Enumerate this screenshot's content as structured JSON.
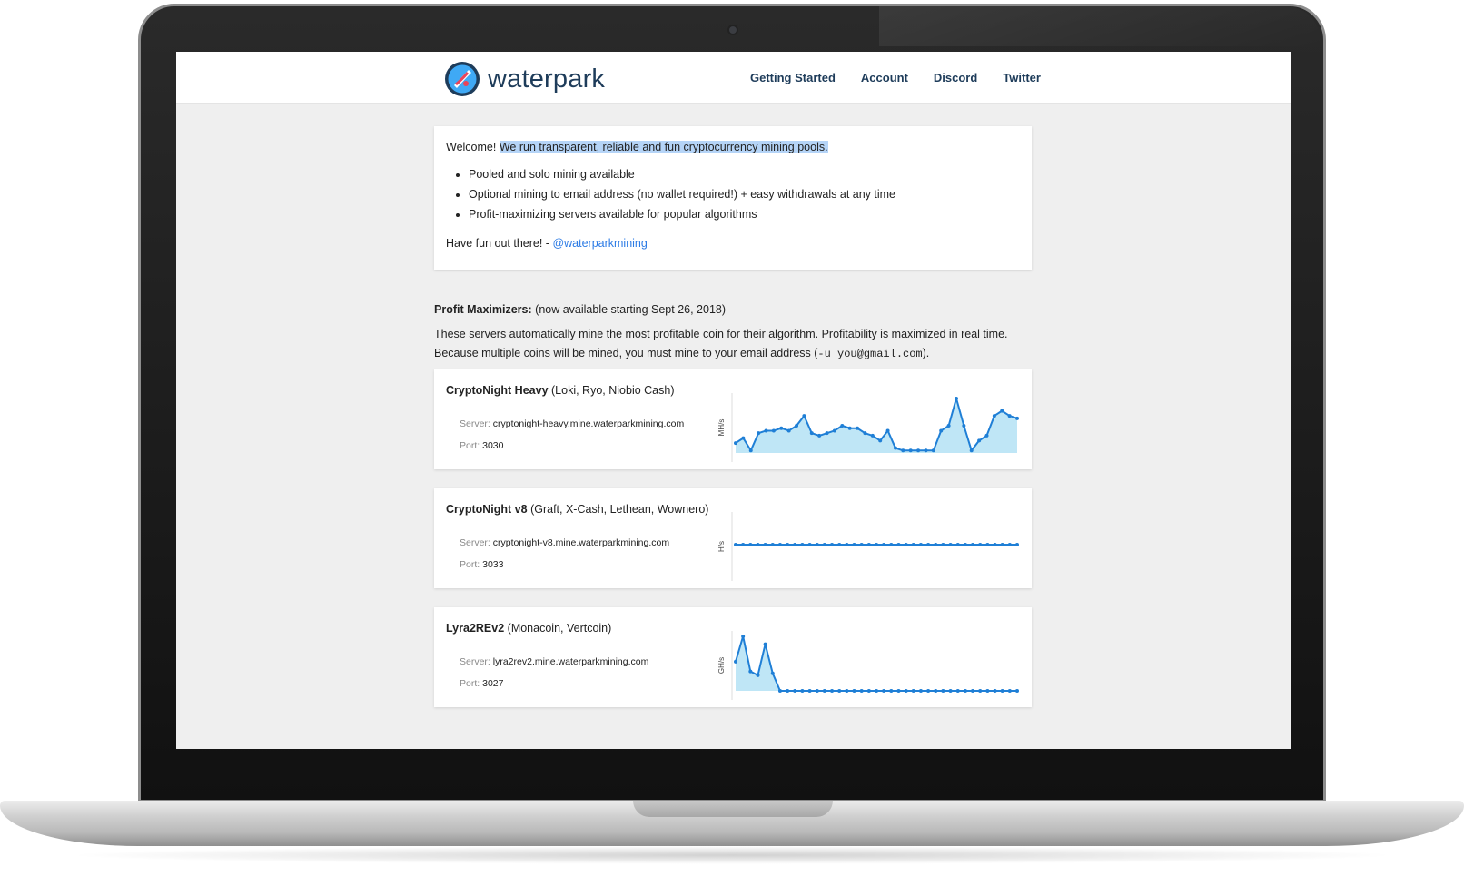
{
  "header": {
    "brand": "waterpark",
    "nav": [
      "Getting Started",
      "Account",
      "Discord",
      "Twitter"
    ]
  },
  "welcome": {
    "greeting": "Welcome!",
    "tagline": "We run transparent, reliable and fun cryptocurrency mining pools.",
    "bullets": [
      "Pooled and solo mining available",
      "Optional mining to email address (no wallet required!) + easy withdrawals at any time",
      "Profit-maximizing servers available for popular algorithms"
    ],
    "signoff": "Have fun out there! -",
    "handle": "@waterparkmining"
  },
  "profit": {
    "title": "Profit Maximizers:",
    "subtitle": "(now available starting Sept 26, 2018)",
    "desc1": "These servers automatically mine the most profitable coin for their algorithm. Profitability is maximized in real time.",
    "desc2_pre": "Because multiple coins will be mined, you must mine to your email address (",
    "desc2_code": "-u you@gmail.com",
    "desc2_post": ")."
  },
  "labels": {
    "server": "Server:",
    "port": "Port:"
  },
  "servers": [
    {
      "name": "CryptoNight Heavy",
      "coins": "(Loki, Ryo, Niobio Cash)",
      "server": "cryptonight-heavy.mine.waterparkmining.com",
      "port": "3030"
    },
    {
      "name": "CryptoNight v8",
      "coins": "(Graft, X-Cash, Lethean, Wownero)",
      "server": "cryptonight-v8.mine.waterparkmining.com",
      "port": "3033"
    },
    {
      "name": "Lyra2REv2",
      "coins": "(Monacoin, Vertcoin)",
      "server": "lyra2rev2.mine.waterparkmining.com",
      "port": "3027"
    }
  ],
  "colors": {
    "line": "#1f7fd6",
    "fill": "#bfe6f6",
    "nav": "#1e3c5a",
    "link": "#2c7be5",
    "highlight": "#b5d4f7"
  },
  "chart_data": [
    {
      "type": "area",
      "ylabel": "MH/s",
      "values": [
        2.0,
        3.0,
        0.5,
        4.0,
        4.5,
        4.5,
        5.0,
        4.5,
        5.5,
        7.5,
        4.0,
        3.5,
        4.0,
        4.5,
        5.5,
        5.0,
        5.0,
        4.0,
        3.5,
        2.5,
        4.5,
        1.0,
        0.5,
        0.5,
        0.5,
        0.5,
        0.5,
        4.5,
        5.5,
        11.0,
        5.5,
        0.5,
        2.5,
        3.5,
        7.5,
        8.5,
        7.5,
        7.0
      ]
    },
    {
      "type": "line",
      "ylabel": "H/s",
      "values": [
        0,
        0,
        0,
        0,
        0,
        0,
        0,
        0,
        0,
        0,
        0,
        0,
        0,
        0,
        0,
        0,
        0,
        0,
        0,
        0,
        0,
        0,
        0,
        0,
        0,
        0,
        0,
        0,
        0,
        0,
        0,
        0,
        0,
        0,
        0,
        0,
        0,
        0,
        0
      ]
    },
    {
      "type": "area",
      "ylabel": "GH/s",
      "values": [
        7.5,
        14.0,
        5.0,
        4.0,
        12.0,
        4.5,
        0,
        0,
        0,
        0,
        0,
        0,
        0,
        0,
        0,
        0,
        0,
        0,
        0,
        0,
        0,
        0,
        0,
        0,
        0,
        0,
        0,
        0,
        0,
        0,
        0,
        0,
        0,
        0,
        0,
        0,
        0,
        0,
        0
      ]
    }
  ]
}
